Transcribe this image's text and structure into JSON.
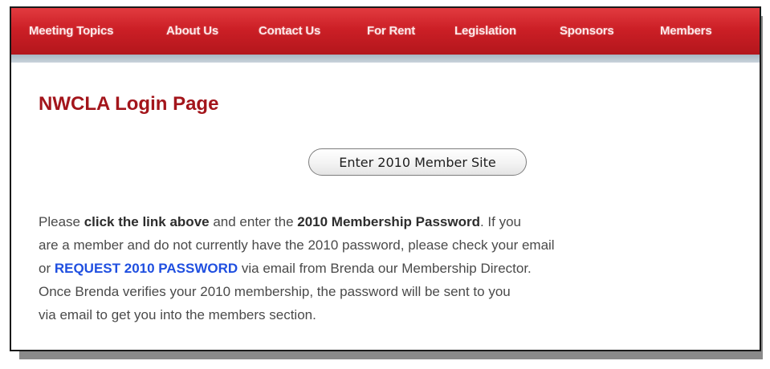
{
  "nav": {
    "items": [
      {
        "label": "Meeting Topics"
      },
      {
        "label": "About Us"
      },
      {
        "label": "Contact Us"
      },
      {
        "label": "For Rent"
      },
      {
        "label": "Legislation"
      },
      {
        "label": "Sponsors"
      },
      {
        "label": "Members"
      }
    ]
  },
  "page": {
    "title": "NWCLA Login Page",
    "member_button_label": "Enter 2010 Member Site"
  },
  "body": {
    "l1_a": "Please ",
    "l1_b": "click the link above",
    "l1_c": " and enter the ",
    "l1_d": "2010 Membership Password",
    "l1_e": ". If you",
    "l2": "are a member and do not currently have the 2010 password, please check your email",
    "l3_a": "or ",
    "l3_link": "REQUEST 2010 PASSWORD",
    "l3_b": " via email from Brenda our Membership Director.",
    "l4": "Once Brenda verifies your 2010 membership, the password will be sent to you",
    "l5": "via email to get you into the members section."
  },
  "colors": {
    "nav_red": "#cc1f26",
    "title_red": "#a3151b",
    "link_blue": "#1f4fe0"
  }
}
